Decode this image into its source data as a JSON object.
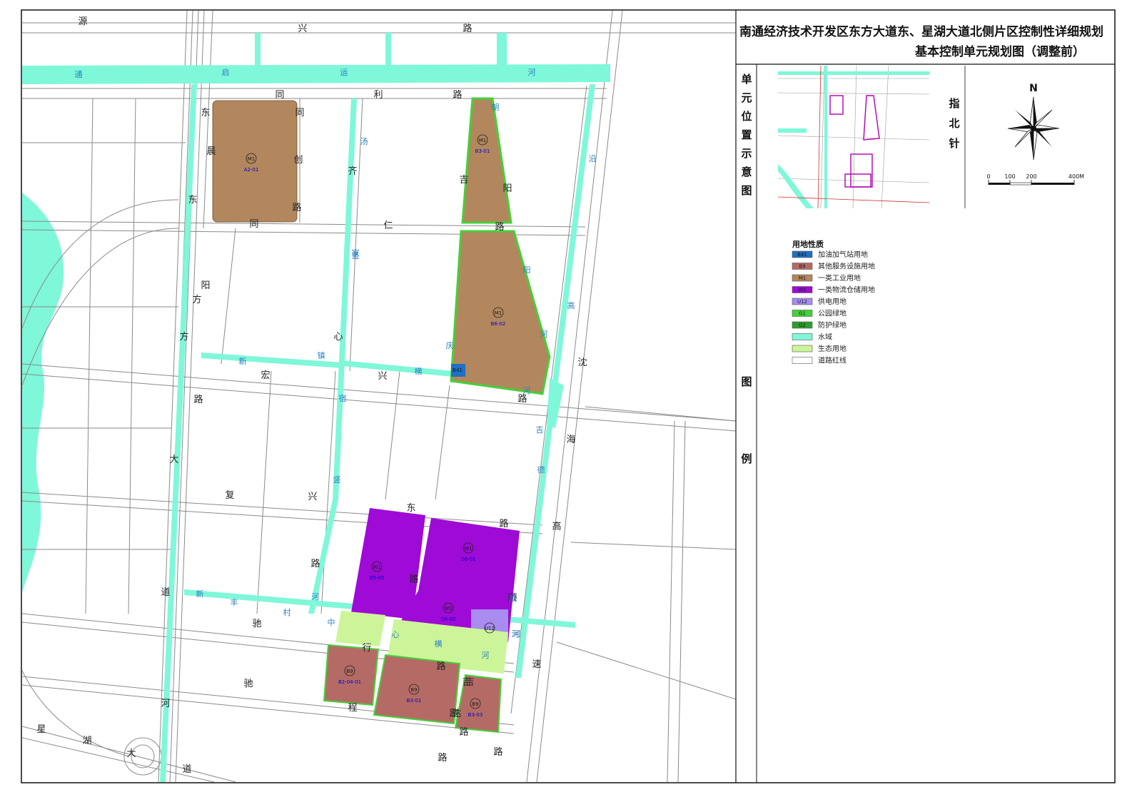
{
  "title": {
    "line1": "南通经济技术开发区东方大道东、星湖大道北侧片区控制性详细规划",
    "line2": "基本控制单元规划图（调整前）"
  },
  "sidebar": {
    "location_label": [
      "单",
      "元",
      "位",
      "置",
      "示",
      "意",
      "图"
    ],
    "legend_label": [
      "图",
      "例"
    ],
    "compass_label": [
      "指",
      "北",
      "针"
    ],
    "north": "N",
    "scale_ticks": [
      "0",
      "100",
      "200",
      "400M"
    ]
  },
  "legend": {
    "title": "用地性质",
    "items": [
      {
        "code": "B41",
        "label": "加油加气站用地",
        "color": "#1f6fc2"
      },
      {
        "code": "B9",
        "label": "其他服务设施用地",
        "color": "#b56b65"
      },
      {
        "code": "M1",
        "label": "一类工业用地",
        "color": "#b3875d"
      },
      {
        "code": "W1",
        "label": "一类物流仓储用地",
        "color": "#9e0ad6"
      },
      {
        "code": "U12",
        "label": "供电用地",
        "color": "#a88cf0"
      },
      {
        "code": "G1",
        "label": "公园绿地",
        "color": "#44d13a"
      },
      {
        "code": "G2",
        "label": "防护绿地",
        "color": "#2e9e2e"
      },
      {
        "code": "",
        "label": "水域",
        "color": "#7ff7d9"
      },
      {
        "code": "",
        "label": "生态用地",
        "color": "#ccf59a"
      },
      {
        "code": "",
        "label": "道路红线",
        "color": "#ffffff"
      }
    ]
  },
  "colors": {
    "water": "#7ff7d9",
    "road": "#888888",
    "industrial": "#b3875d",
    "logistics": "#9e0ad6",
    "service": "#b56b65",
    "power": "#a88cf0",
    "eco": "#ccf59a",
    "green": "#44d13a"
  },
  "plots": [
    {
      "code": "M1",
      "id": "A2-01",
      "type": "industrial"
    },
    {
      "code": "M1",
      "id": "B3-01",
      "type": "industrial"
    },
    {
      "code": "M1",
      "id": "B6-02",
      "type": "industrial"
    },
    {
      "code": "B41",
      "id": "",
      "type": "gas"
    },
    {
      "code": "W1",
      "id": "B5-05",
      "type": "logistics"
    },
    {
      "code": "W1",
      "id": "D6-01",
      "type": "logistics"
    },
    {
      "code": "W1",
      "id": "D6-02",
      "type": "logistics"
    },
    {
      "code": "U12",
      "id": "",
      "type": "power"
    },
    {
      "code": "B9",
      "id": "B2-04-01",
      "type": "service"
    },
    {
      "code": "B9",
      "id": "B3-01",
      "type": "service"
    },
    {
      "code": "B9",
      "id": "B3-03",
      "type": "service"
    }
  ],
  "road_chars": {
    "yuanxing": [
      "源",
      "兴",
      "路"
    ],
    "qiyun": [
      "通",
      "启",
      "运",
      "河"
    ],
    "tongli": [
      "同",
      "利",
      "路"
    ],
    "dongchen": [
      "东",
      "晨"
    ],
    "tongchuang": [
      "同",
      "创",
      "路"
    ],
    "tongchuang_bottom": [
      "同"
    ],
    "tangjia": [
      "汤",
      "家"
    ],
    "qiren": [
      "齐",
      "仁",
      "路"
    ],
    "jiyang": [
      "吉",
      "阳"
    ],
    "chaoyang": [
      "朝",
      "阳"
    ],
    "yanhegao": [
      "沿",
      "高"
    ],
    "dongfang": [
      "东",
      "阳",
      "方",
      "路",
      "大",
      "道"
    ],
    "shunfang": [
      "方",
      "顺"
    ],
    "hongxingxin": [
      "宏",
      "心",
      "兴",
      "路"
    ],
    "xinzhen": [
      "新",
      "镇"
    ],
    "qinghe": [
      "庆",
      "横",
      "河"
    ],
    "yongqin": [
      "竖",
      "河"
    ],
    "shenhai": [
      "沈",
      "海",
      "高",
      "速"
    ],
    "jiji": [
      "吉",
      "德",
      "河"
    ],
    "fuxing": [
      "复",
      "兴",
      "东",
      "路"
    ],
    "fuxing_south": [
      "路",
      "路"
    ],
    "sushu": [
      "宿",
      "竖",
      "河"
    ],
    "xinfengcun": [
      "新",
      "丰",
      "村",
      "中",
      "心",
      "横",
      "河"
    ],
    "chixing": [
      "驰",
      "行",
      "路"
    ],
    "shunhe": [
      "顺",
      "河"
    ],
    "chicheng": [
      "驰",
      "程",
      "路"
    ],
    "jida": [
      "吉",
      "达",
      "路"
    ],
    "xinghu": [
      "星",
      "湖",
      "大",
      "道"
    ],
    "misc": [
      "路",
      "路",
      "河",
      "吉"
    ]
  }
}
